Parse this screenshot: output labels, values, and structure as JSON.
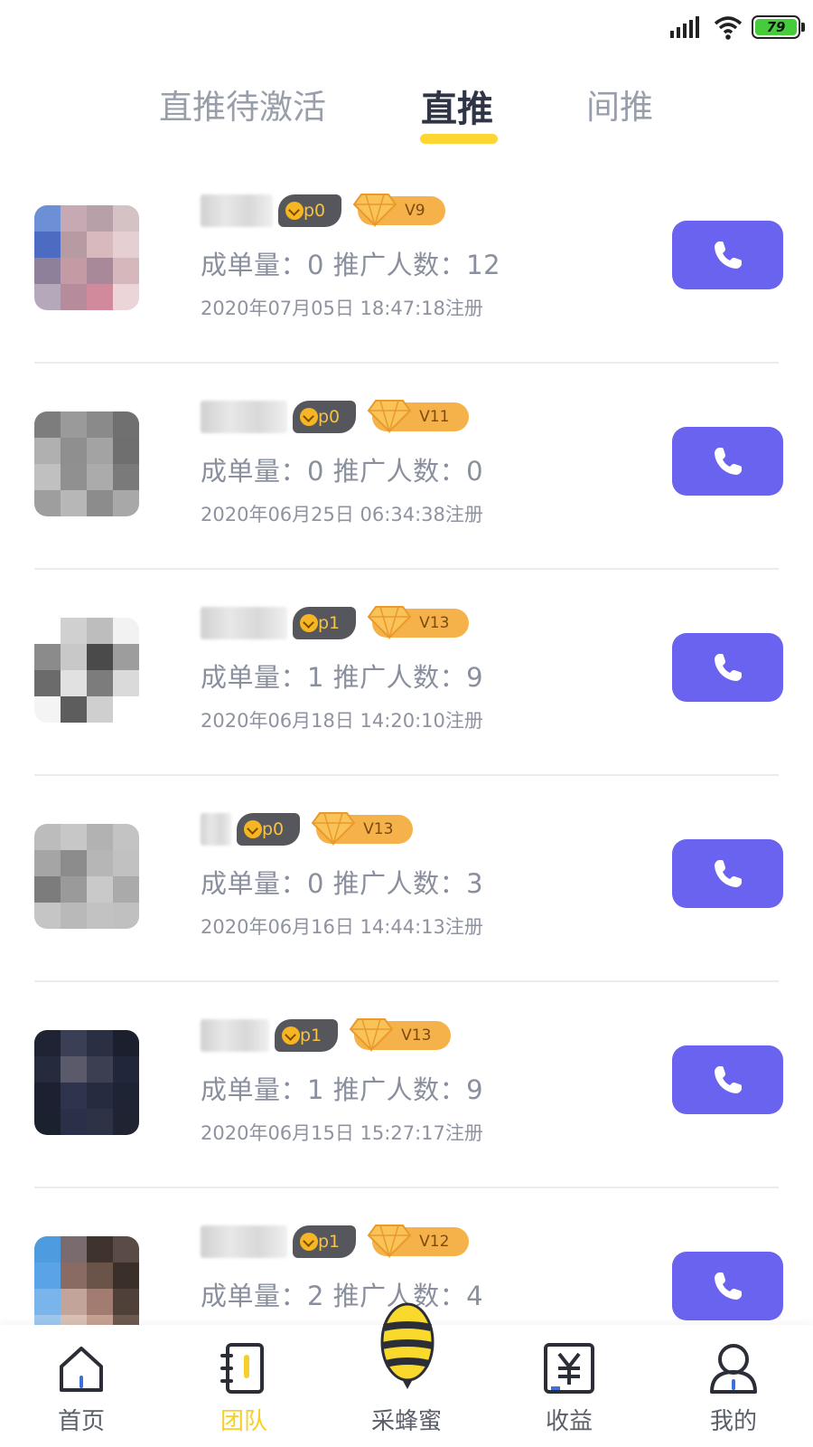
{
  "status_bar": {
    "battery": "79"
  },
  "tabs": [
    {
      "label": "直推待激活",
      "active": false
    },
    {
      "label": "直推",
      "active": true
    },
    {
      "label": "间推",
      "active": false
    }
  ],
  "members": [
    {
      "p_level": "p0",
      "v_level": "V9",
      "stats": "成单量：0  推广人数：12",
      "date": "2020年07月05日 18:47:18注册"
    },
    {
      "p_level": "p0",
      "v_level": "V11",
      "stats": "成单量：0  推广人数：0",
      "date": "2020年06月25日 06:34:38注册"
    },
    {
      "p_level": "p1",
      "v_level": "V13",
      "stats": "成单量：1  推广人数：9",
      "date": "2020年06月18日 14:20:10注册"
    },
    {
      "p_level": "p0",
      "v_level": "V13",
      "stats": "成单量：0  推广人数：3",
      "date": "2020年06月16日 14:44:13注册"
    },
    {
      "p_level": "p1",
      "v_level": "V13",
      "stats": "成单量：1  推广人数：9",
      "date": "2020年06月15日 15:27:17注册"
    },
    {
      "p_level": "p1",
      "v_level": "V12",
      "stats": "成单量：2  推广人数：4",
      "date": ""
    }
  ],
  "nav": [
    {
      "label": "首页",
      "icon": "home-icon"
    },
    {
      "label": "团队",
      "icon": "team-icon",
      "active": true
    },
    {
      "label": "采蜂蜜",
      "icon": "bee-icon"
    },
    {
      "label": "收益",
      "icon": "yen-icon"
    },
    {
      "label": "我的",
      "icon": "user-icon"
    }
  ],
  "colors": {
    "accent_yellow": "#fdd634",
    "call_button": "#6a63ef",
    "vip_badge": "#f6b24a"
  }
}
